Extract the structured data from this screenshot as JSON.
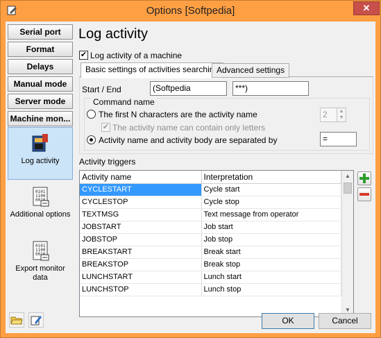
{
  "window": {
    "title": "Options [Softpedia]",
    "close_glyph": "✕",
    "accent_color": "#ff9f43"
  },
  "nav": {
    "buttons": [
      "Serial port",
      "Format",
      "Delays",
      "Manual mode",
      "Server mode",
      "Machine mon..."
    ],
    "big_items": [
      {
        "label": "Log activity",
        "icon": "log-activity-icon",
        "active": true
      },
      {
        "label": "Additional options",
        "icon": "binary-document-icon",
        "active": false
      },
      {
        "label": "Export monitor data",
        "icon": "binary-export-icon",
        "active": false
      }
    ]
  },
  "main": {
    "heading": "Log activity",
    "log_checkbox": {
      "label": "Log activity of a machine",
      "checked": true
    },
    "tabs": [
      "Basic settings of activities searching",
      "Advanced settings"
    ],
    "active_tab": 0,
    "start_end": {
      "label": "Start / End",
      "start_value": "(Softpedia",
      "end_value": "***)"
    },
    "command_name": {
      "title": "Command name",
      "option1": "The first N characters are the activity name",
      "option1_value": "2",
      "sub_checkbox": "The activity name can contain only letters",
      "option2": "Activity name and activity body are separated by",
      "option2_value": "=",
      "selected": 2
    },
    "triggers": {
      "title": "Activity triggers",
      "columns": [
        "Activity name",
        "Interpretation"
      ],
      "rows": [
        [
          "CYCLESTART",
          "Cycle start"
        ],
        [
          "CYCLESTOP",
          "Cycle stop"
        ],
        [
          "TEXTMSG",
          "Text message from operator"
        ],
        [
          "JOBSTART",
          "Job start"
        ],
        [
          "JOBSTOP",
          "Job stop"
        ],
        [
          "BREAKSTART",
          "Break start"
        ],
        [
          "BREAKSTOP",
          "Break stop"
        ],
        [
          "LUNCHSTART",
          "Lunch start"
        ],
        [
          "LUNCHSTOP",
          "Lunch stop"
        ]
      ],
      "selected_row": 0
    }
  },
  "footer": {
    "ok_label": "OK",
    "cancel_label": "Cancel"
  },
  "colors": {
    "selection": "#3399ff",
    "add_green": "#2e9e2e",
    "remove_red": "#d63a2a"
  }
}
